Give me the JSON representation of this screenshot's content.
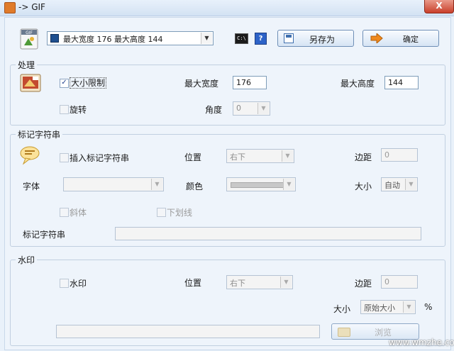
{
  "window": {
    "title": "-> GIF",
    "close_label": "X"
  },
  "toolbar": {
    "preset_value": "最大宽度 176 最大高度 144",
    "cmd_icon_label": "C:\\",
    "help_label": "?",
    "save_as_label": "另存为",
    "ok_label": "确定"
  },
  "process": {
    "group_label": "处理",
    "size_limit_label": "大小限制",
    "size_limit_checked": true,
    "max_width_label": "最大宽度",
    "max_width_value": "176",
    "max_height_label": "最大高度",
    "max_height_value": "144",
    "rotate_label": "旋转",
    "angle_label": "角度",
    "angle_value": "0"
  },
  "marker": {
    "group_label": "标记字符串",
    "insert_label": "插入标记字符串",
    "position_label": "位置",
    "position_value": "右下",
    "margin_label": "边距",
    "margin_value": "0",
    "font_label": "字体",
    "font_value": "",
    "color_label": "颜色",
    "size_label": "大小",
    "size_value": "自动",
    "italic_label": "斜体",
    "underline_label": "下划线",
    "string_label": "标记字符串",
    "string_value": ""
  },
  "watermark": {
    "group_label": "水印",
    "watermark_label": "水印",
    "position_label": "位置",
    "position_value": "右下",
    "margin_label": "边距",
    "margin_value": "0",
    "size_label": "大小",
    "size_value": "原始大小",
    "percent_label": "%",
    "path_value": "",
    "browse_label": "浏览"
  },
  "footer": {
    "site_text": "www.wmzhe.com"
  }
}
